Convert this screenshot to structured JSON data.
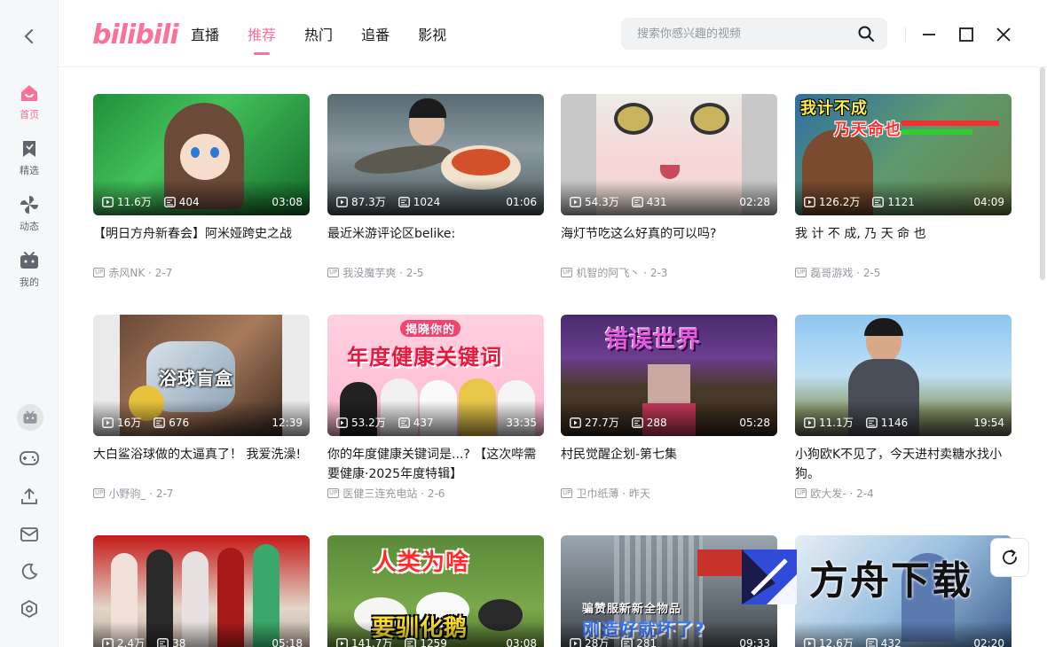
{
  "app": {
    "logo": "bilibili"
  },
  "sidebar": {
    "items": [
      {
        "label": "首页",
        "icon": "home-icon"
      },
      {
        "label": "精选",
        "icon": "bookmark-icon"
      },
      {
        "label": "动态",
        "icon": "pinwheel-icon"
      },
      {
        "label": "我的",
        "icon": "tv-icon"
      }
    ],
    "tools": [
      "avatar",
      "gamepad-icon",
      "upload-icon",
      "mail-icon",
      "moon-icon",
      "settings-icon"
    ]
  },
  "header": {
    "tabs": [
      {
        "label": "直播"
      },
      {
        "label": "推荐"
      },
      {
        "label": "热门"
      },
      {
        "label": "追番"
      },
      {
        "label": "影视"
      }
    ],
    "active_tab": "推荐",
    "search": {
      "placeholder": "搜索你感兴趣的视频"
    }
  },
  "colors": {
    "accent": "#fb7299",
    "text": "#18191c",
    "muted": "#9499a0"
  },
  "videos": [
    {
      "views": "11.6万",
      "danmaku": "404",
      "duration": "03:08",
      "title": "【明日方舟新春会】阿米娅跨史之战",
      "uploader": "赤风NK",
      "date": "2-7",
      "overlay": ""
    },
    {
      "views": "87.3万",
      "danmaku": "1024",
      "duration": "01:06",
      "title": "最近米游评论区belike:",
      "uploader": "我没魔芋爽",
      "date": "2-5",
      "overlay": ""
    },
    {
      "views": "54.3万",
      "danmaku": "431",
      "duration": "02:28",
      "title": "海灯节吃这么好真的可以吗?",
      "uploader": "机智的阿飞丶",
      "date": "2-3",
      "overlay": ""
    },
    {
      "views": "126.2万",
      "danmaku": "1121",
      "duration": "04:09",
      "title": "我 计 不 成, 乃 天 命 也",
      "uploader": "磊哥游戏",
      "date": "2-5",
      "overlay": "我计不成",
      "overlay2": "乃天命也"
    },
    {
      "views": "16万",
      "danmaku": "676",
      "duration": "12:39",
      "title": "大白鲨浴球做的太逼真了！ 我爱洗澡!",
      "uploader": "小野驹_",
      "date": "2-7",
      "overlay": "浴球盲盒"
    },
    {
      "views": "53.2万",
      "danmaku": "437",
      "duration": "33:35",
      "title": "你的年度健康关键词是...? 【这次哔需要健康·2025年度特辑】",
      "uploader": "医健三连充电站",
      "date": "2-6",
      "overlay": "揭晓你的",
      "overlay2": "年度健康关键词"
    },
    {
      "views": "27.7万",
      "danmaku": "288",
      "duration": "05:28",
      "title": "村民觉醒企划-第七集",
      "uploader": "卫巾纸薄",
      "date": "昨天",
      "overlay": "错误世界"
    },
    {
      "views": "11.1万",
      "danmaku": "1146",
      "duration": "19:54",
      "title": "小狗欧K不见了，今天进村卖糖水找小狗。",
      "uploader": "欧大发-",
      "date": "2-4",
      "overlay": ""
    },
    {
      "views": "2.4万",
      "danmaku": "38",
      "duration": "05:18",
      "title": "",
      "uploader": "",
      "date": "",
      "overlay": ""
    },
    {
      "views": "141.7万",
      "danmaku": "1259",
      "duration": "03:08",
      "title": "",
      "uploader": "",
      "date": "",
      "overlay": "人类为啥",
      "overlay2": "要驯化鹅"
    },
    {
      "views": "28万",
      "danmaku": "281",
      "duration": "09:33",
      "title": "",
      "uploader": "",
      "date": "",
      "overlay": "骗赞服新新全物品",
      "overlay2": "刚造好就坏了?"
    },
    {
      "views": "12.6万",
      "danmaku": "432",
      "duration": "02:20",
      "title": "",
      "uploader": "",
      "date": "",
      "overlay": ""
    }
  ],
  "watermark": {
    "text": "方舟下载"
  }
}
